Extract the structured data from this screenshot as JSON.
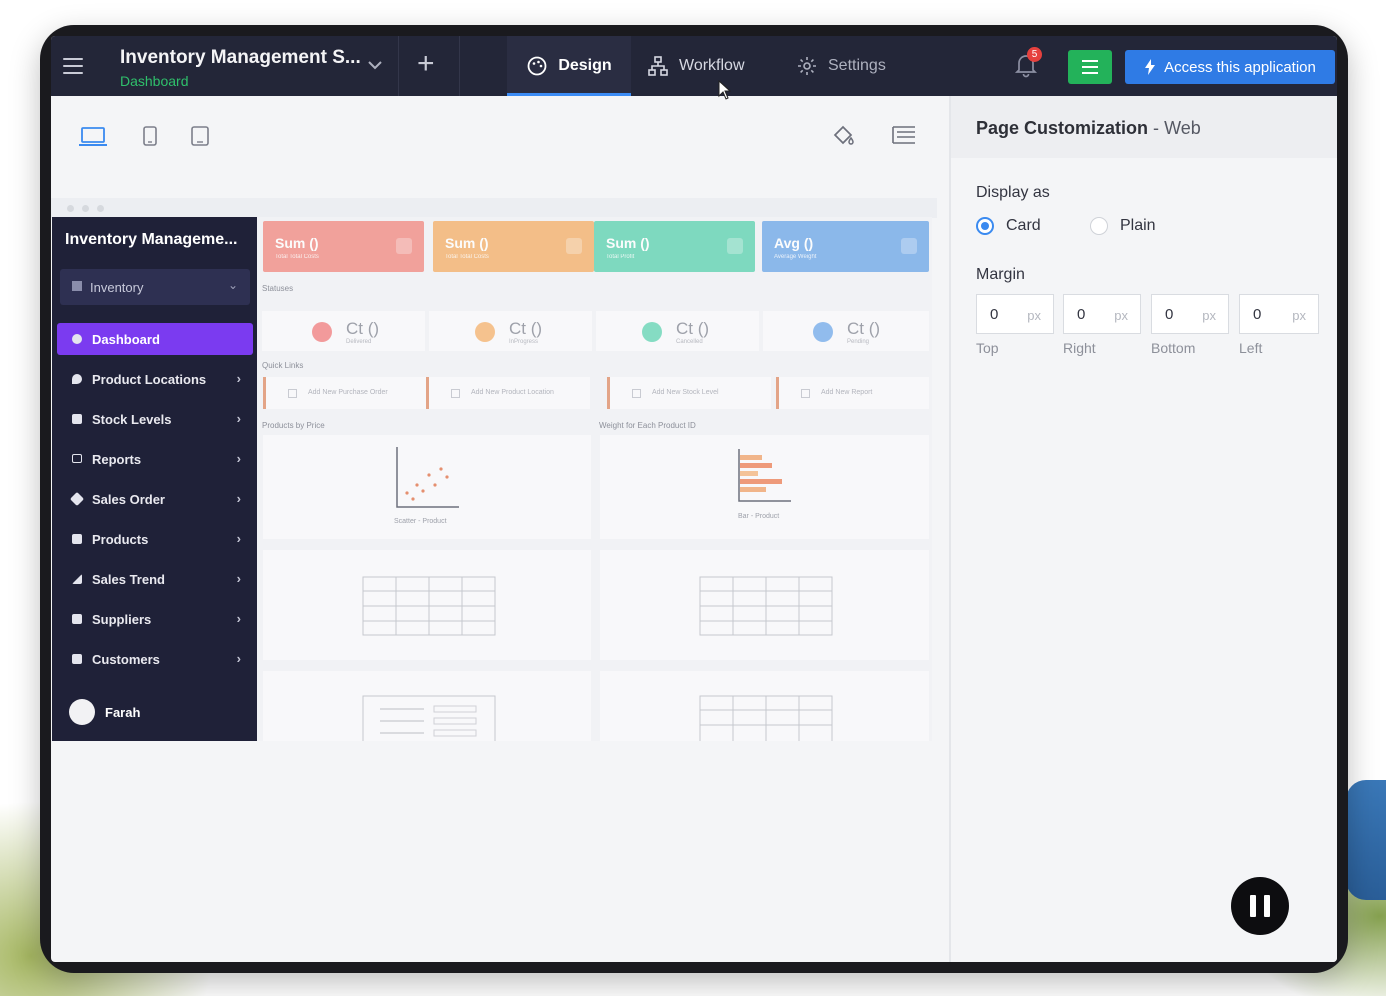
{
  "topbar": {
    "app_title": "Inventory Management S...",
    "app_subtitle": "Dashboard",
    "tabs": [
      {
        "label": "Design",
        "icon": "palette-icon",
        "active": true
      },
      {
        "label": "Workflow",
        "icon": "workflow-icon",
        "active": false
      },
      {
        "label": "Settings",
        "icon": "gear-icon",
        "active": false
      }
    ],
    "notification_count": "5",
    "access_label": "Access this application"
  },
  "preview": {
    "sidebar": {
      "title": "Inventory Manageme...",
      "section": "Inventory",
      "items": [
        {
          "label": "Dashboard",
          "active": true
        },
        {
          "label": "Product Locations"
        },
        {
          "label": "Stock Levels"
        },
        {
          "label": "Reports"
        },
        {
          "label": "Sales Order"
        },
        {
          "label": "Products"
        },
        {
          "label": "Sales Trend"
        },
        {
          "label": "Suppliers"
        },
        {
          "label": "Customers"
        }
      ],
      "user": "Farah"
    },
    "kpis": [
      {
        "value": "Sum ()",
        "sub": "Total Total Costs",
        "color": "#f28b82"
      },
      {
        "value": "Sum ()",
        "sub": "Total Total Costs",
        "color": "#f4b06a"
      },
      {
        "value": "Sum ()",
        "sub": "Total Profit",
        "color": "#5fd3b0"
      },
      {
        "value": "Avg ()",
        "sub": "Average Weight",
        "color": "#6fa8e8"
      }
    ],
    "statuses_label": "Statuses",
    "statuses": [
      {
        "value": "Ct ()",
        "sub": "Delivered",
        "color": "#f07b7b"
      },
      {
        "value": "Ct ()",
        "sub": "InProgress",
        "color": "#f4b06a"
      },
      {
        "value": "Ct ()",
        "sub": "Cancelled",
        "color": "#5fd3b0"
      },
      {
        "value": "Ct ()",
        "sub": "Pending",
        "color": "#6fa8e8"
      }
    ],
    "quick_links_label": "Quick Links",
    "quick_links": [
      "Add New Purchase Order",
      "Add New Product Location",
      "Add New Stock Level",
      "Add New Report"
    ],
    "chart_titles": [
      "Products by Price",
      "Weight for Each Product ID"
    ],
    "chart_captions": [
      "Scatter - Product",
      "Bar - Product"
    ]
  },
  "panel": {
    "title": "Page Customization",
    "title_sep": "-",
    "title_sub": "Web",
    "display_label": "Display as",
    "display_options": [
      {
        "label": "Card",
        "selected": true
      },
      {
        "label": "Plain",
        "selected": false
      }
    ],
    "margin_label": "Margin",
    "margins": [
      {
        "value": "0",
        "unit": "px",
        "caption": "Top"
      },
      {
        "value": "0",
        "unit": "px",
        "caption": "Right"
      },
      {
        "value": "0",
        "unit": "px",
        "caption": "Bottom"
      },
      {
        "value": "0",
        "unit": "px",
        "caption": "Left"
      }
    ]
  }
}
